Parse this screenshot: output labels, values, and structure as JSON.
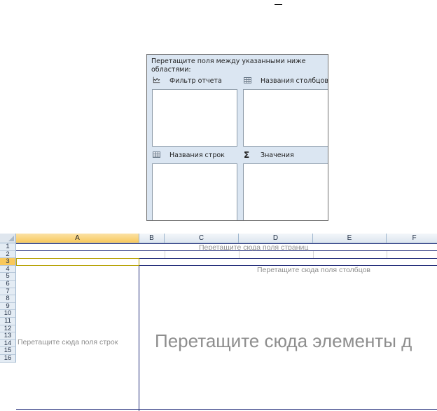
{
  "field_list": {
    "instruction": "Перетащите поля между указанными ниже областями:",
    "areas": {
      "report_filter": "Фильтр отчета",
      "column_labels": "Названия столбцов",
      "row_labels": "Названия строк",
      "values": "Значения"
    },
    "icons": {
      "report_filter": "funnel-icon",
      "column_labels": "grid-icon",
      "row_labels": "grid-icon",
      "values": "sigma-icon"
    }
  },
  "sheet": {
    "columns": [
      "A",
      "B",
      "C",
      "D",
      "E",
      "F"
    ],
    "rows": [
      "1",
      "2",
      "3",
      "4",
      "5",
      "6",
      "7",
      "8",
      "9",
      "10",
      "11",
      "12",
      "13",
      "14",
      "15",
      "16"
    ],
    "selected_column": "A",
    "selected_row": "3",
    "placeholders": {
      "page_fields": "Перетащите сюда поля страниц",
      "column_fields": "Перетащите сюда поля столбцов",
      "row_fields": "Перетащите сюда поля строк",
      "data_items": "Перетащите сюда элементы д"
    },
    "colors": {
      "pivot_border": "#1f2a78",
      "header_selected": "#f8c85c",
      "placeholder_text": "#8e8e8e"
    }
  }
}
